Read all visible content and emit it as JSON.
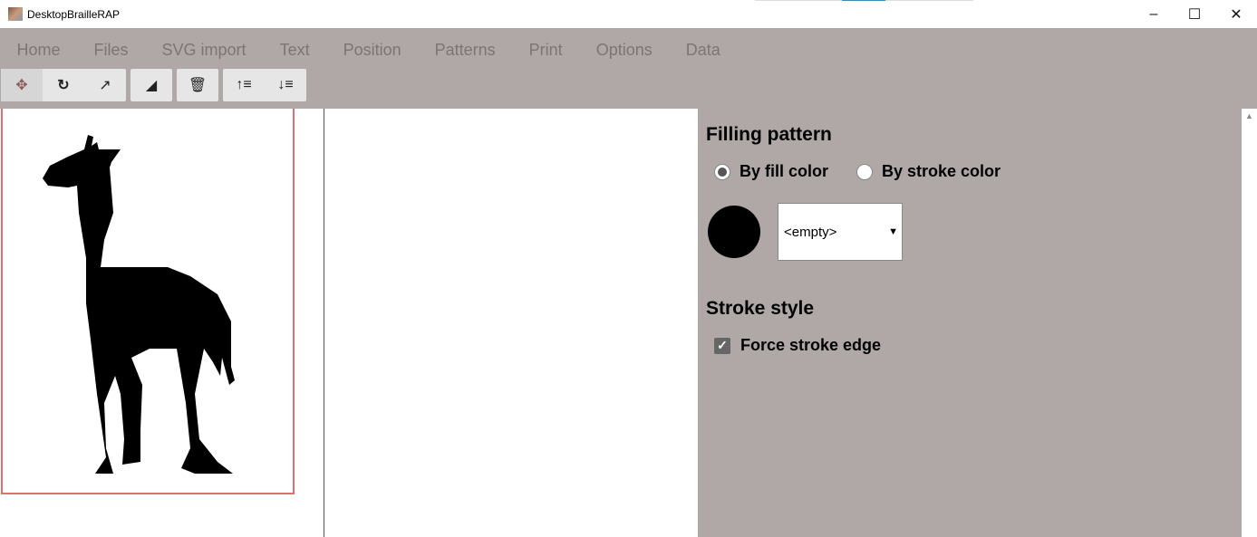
{
  "window": {
    "title": "DesktopBrailleRAP"
  },
  "menu": [
    "Home",
    "Files",
    "SVG import",
    "Text",
    "Position",
    "Patterns",
    "Print",
    "Options",
    "Data"
  ],
  "toolbar": {
    "icons": [
      "move-icon",
      "rotate-icon",
      "external-link-icon",
      "eraser-icon",
      "trash-icon",
      "sort-up-icon",
      "sort-down-icon"
    ]
  },
  "panel": {
    "filling_title": "Filling pattern",
    "by_fill": "By fill color",
    "by_stroke": "By stroke color",
    "swatch_color": "#000000",
    "pattern_value": "<empty>",
    "stroke_title": "Stroke style",
    "force_stroke": "Force stroke edge"
  }
}
